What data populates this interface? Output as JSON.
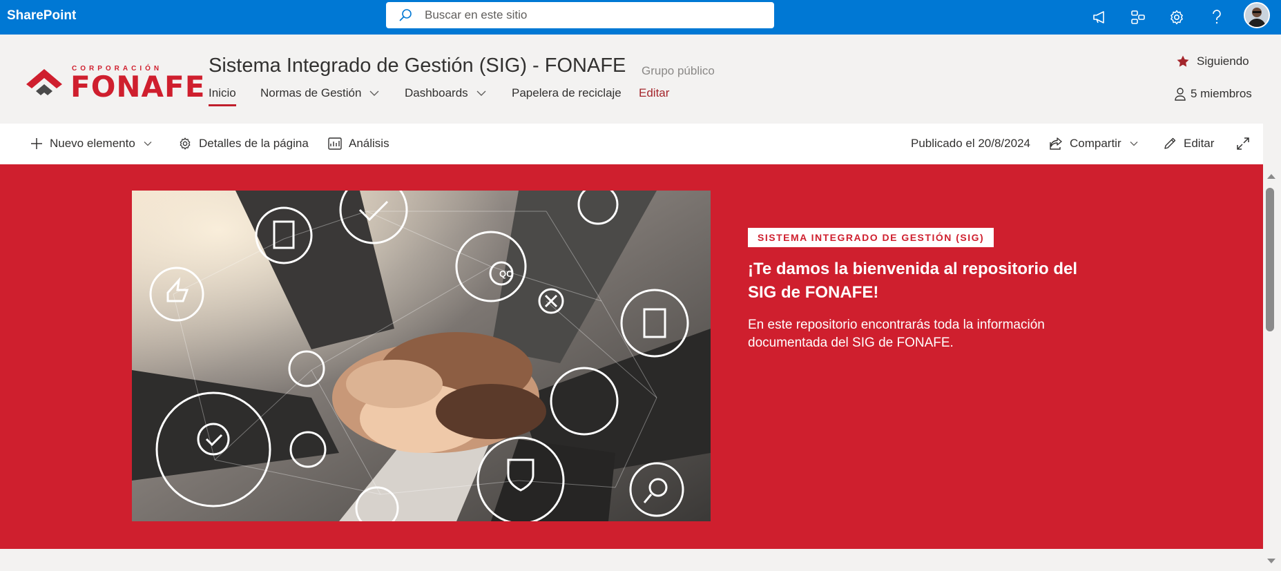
{
  "suite": {
    "brand": "SharePoint",
    "search_placeholder": "Buscar en este sitio"
  },
  "site": {
    "logo_top": "CORPORACIÓN",
    "logo_name": "FONAFE",
    "title": "Sistema Integrado de Gestión (SIG) - FONAFE",
    "group": "Grupo público",
    "follow": "Siguiendo",
    "members": "5 miembros",
    "nav": [
      {
        "label": "Inicio"
      },
      {
        "label": "Normas de Gestión"
      },
      {
        "label": "Dashboards"
      },
      {
        "label": "Papelera de reciclaje"
      },
      {
        "label": "Editar"
      }
    ]
  },
  "commandbar": {
    "new_item": "Nuevo elemento",
    "page_details": "Detalles de la página",
    "analytics": "Análisis",
    "published": "Publicado el 20/8/2024",
    "share": "Compartir",
    "edit": "Editar"
  },
  "hero": {
    "tag": "SISTEMA INTEGRADO DE GESTIÓN (SIG)",
    "title": "¡Te damos la bienvenida al repositorio del SIG de FONAFE!",
    "text": "En este repositorio encontrarás toda la información documentada del SIG de FONAFE.",
    "image_icons": [
      "checkmark-gear-icon",
      "document-icon",
      "thumbs-up-icon",
      "qc-gears-icon",
      "person-icon",
      "tools-icon",
      "certificate-icon",
      "people-icon",
      "hands-gear-icon",
      "shield-handshake-icon",
      "gears-search-icon",
      "search-icon"
    ]
  },
  "colors": {
    "suitebar": "#0078d4",
    "brand_red": "#cf1f2e",
    "header_bg": "#f3f2f1"
  }
}
